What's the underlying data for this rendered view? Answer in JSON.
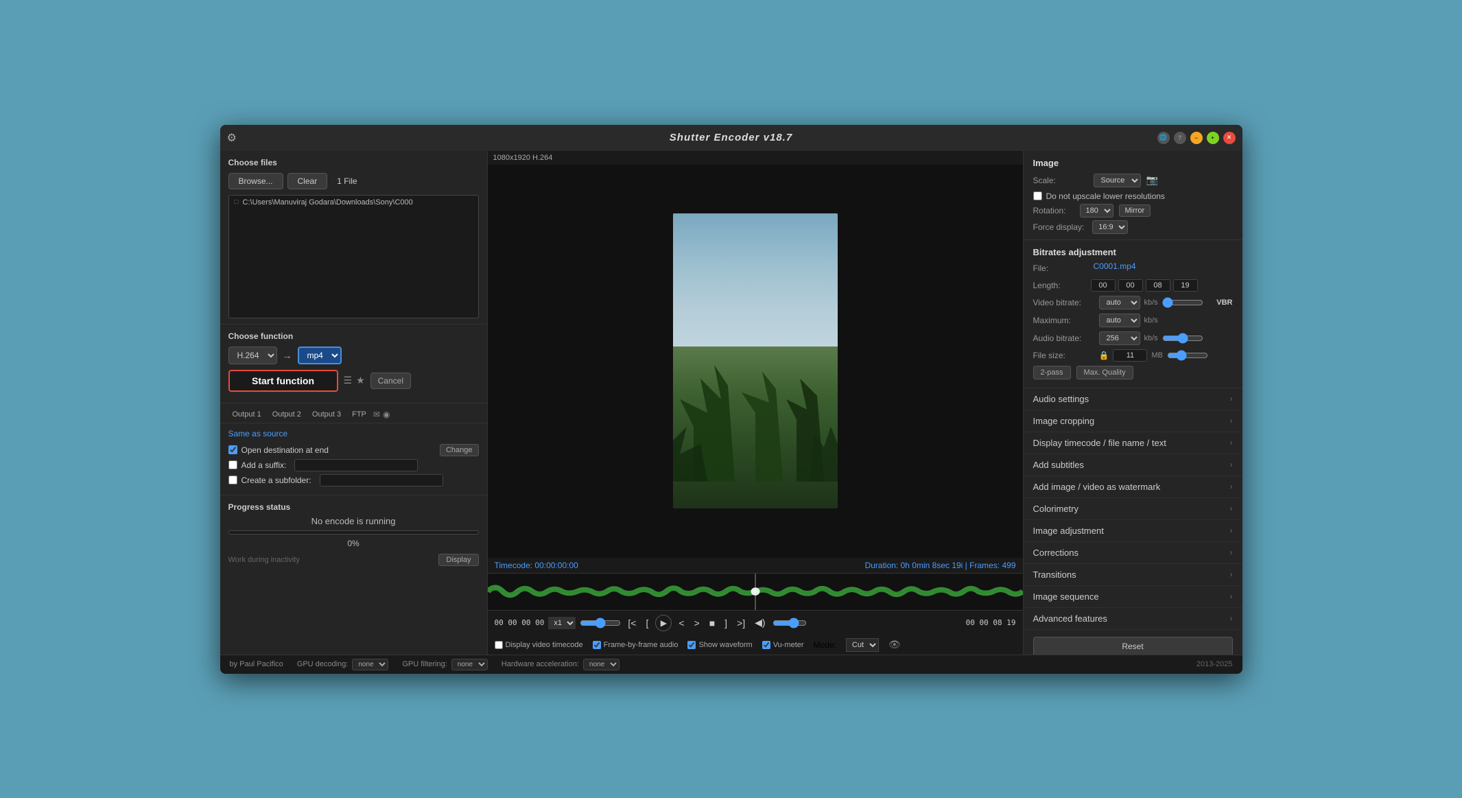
{
  "app": {
    "title": "Shutter Encoder v18.7",
    "gear_icon": "⚙",
    "year_range": "2013-2025"
  },
  "title_buttons": {
    "globe": "🌐",
    "help": "?",
    "minimize": "−",
    "maximize": "+",
    "close": "✕"
  },
  "left_panel": {
    "choose_files_title": "Choose files",
    "browse_label": "Browse...",
    "clear_label": "Clear",
    "file_count": "1 File",
    "file_path": "C:\\Users\\Manuviraj Godara\\Downloads\\Sony\\C000",
    "choose_function_title": "Choose function",
    "function_select": "H.264",
    "output_format": "mp4",
    "start_button": "Start function",
    "cancel_button": "Cancel",
    "output_tabs": [
      "Output 1",
      "Output 2",
      "Output 3",
      "FTP"
    ],
    "same_as_source": "Same as source",
    "open_destination_label": "Open destination at end",
    "change_label": "Change",
    "add_suffix_label": "Add a suffix:",
    "create_subfolder_label": "Create a subfolder:",
    "progress_title": "Progress status",
    "progress_status": "No encode is running",
    "progress_percent": "0%",
    "work_inactivity": "Work during inactivity",
    "display_label": "Display"
  },
  "center_panel": {
    "video_info": "1080x1920 H.264",
    "timecode_label": "Timecode:",
    "timecode_value": "00:00:00:00",
    "duration_label": "Duration:",
    "duration_value": "0h 0min 8sec 19i | Frames: 499",
    "time_start": "00 00 00 00",
    "speed": "x1",
    "time_end": "00 00 08 19",
    "display_timecode_label": "Display video timecode",
    "frame_audio_label": "Frame-by-frame audio",
    "show_waveform_label": "Show waveform",
    "vu_meter_label": "Vu-meter",
    "mode_label": "Mode:",
    "mode_value": "Cut"
  },
  "right_panel": {
    "image_section_title": "Image",
    "scale_label": "Scale:",
    "scale_value": "Source",
    "do_not_upscale": "Do not upscale lower resolutions",
    "rotation_label": "Rotation:",
    "rotation_value": "180",
    "mirror_label": "Mirror",
    "force_display_label": "Force display:",
    "force_display_value": "16:9",
    "bitrates_title": "Bitrates adjustment",
    "file_label": "File:",
    "file_name": "C0001.mp4",
    "length_label": "Length:",
    "length_h": "00",
    "length_m": "00",
    "length_s": "08",
    "length_f": "19",
    "video_bitrate_label": "Video bitrate:",
    "video_bitrate_value": "auto",
    "video_bitrate_unit": "kb/s",
    "vbr_label": "VBR",
    "max_label": "Maximum:",
    "max_value": "auto",
    "max_unit": "kb/s",
    "audio_bitrate_label": "Audio bitrate:",
    "audio_bitrate_value": "256",
    "audio_bitrate_unit": "kb/s",
    "file_size_label": "File size:",
    "file_size_value": "11",
    "file_size_unit": "MB",
    "twopass_label": "2-pass",
    "max_quality_label": "Max. Quality",
    "menu_items": [
      "Audio settings",
      "Image cropping",
      "Display timecode / file name / text",
      "Add subtitles",
      "Add image / video as watermark",
      "Colorimetry",
      "Image adjustment",
      "Corrections",
      "Transitions",
      "Image sequence",
      "Advanced features"
    ],
    "reset_label": "Reset"
  },
  "status_bar": {
    "author": "by Paul Pacifico",
    "gpu_decoding_label": "GPU decoding:",
    "gpu_decoding_value": "none",
    "gpu_filtering_label": "GPU filtering:",
    "gpu_filtering_value": "none",
    "hw_accel_label": "Hardware acceleration:",
    "hw_accel_value": "none"
  }
}
